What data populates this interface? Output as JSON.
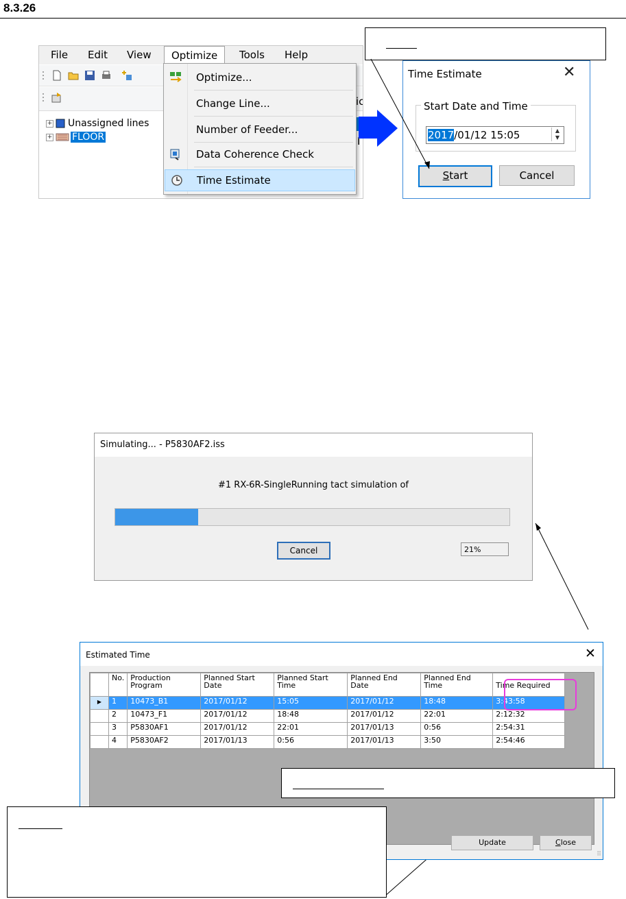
{
  "section": {
    "number": "8.3.26"
  },
  "app_window": {
    "menu": [
      "File",
      "Edit",
      "View",
      "Optimize",
      "Tools",
      "Help"
    ],
    "active_menu": "Optimize",
    "tree": [
      {
        "label": "Unassigned lines"
      },
      {
        "label": "FLOOR"
      }
    ],
    "panel_fragments": [
      "ic",
      "I"
    ],
    "optimize_menu": [
      {
        "label": "Optimize...",
        "icon": "optimize-icon"
      },
      {
        "label": "Change Line...",
        "icon": ""
      },
      {
        "label": "Number of Feeder...",
        "icon": ""
      },
      {
        "label": "Data Coherence Check",
        "icon": "data-check-icon"
      },
      {
        "label": "Time Estimate",
        "icon": "clock-icon"
      }
    ]
  },
  "time_estimate_dialog": {
    "title": "Time Estimate",
    "close": "✕",
    "group_label": "Start Date and Time",
    "value_year": "2017",
    "value_rest": "/01/12 15:05",
    "start_button": "Start",
    "start_button_mnemonic": "S",
    "start_button_rest": "tart",
    "cancel_button": "Cancel"
  },
  "simulating_dialog": {
    "title": "Simulating... - P5830AF2.iss",
    "message": "#1 RX-6R-SingleRunning tact simulation of",
    "progress": 21,
    "progress_label": "21%",
    "cancel": "Cancel"
  },
  "estimated_time_dialog": {
    "title": "Estimated Time",
    "close": "✕",
    "columns": [
      "No.",
      "Production\nProgram",
      "Planned Start\nDate",
      "Planned Start\nTime",
      "Planned End\nDate",
      "Planned End\nTime",
      "Time Required"
    ],
    "rows": [
      [
        "1",
        "10473_B1",
        "2017/01/12",
        "15:05",
        "2017/01/12",
        "18:48",
        "3:43:58"
      ],
      [
        "2",
        "10473_F1",
        "2017/01/12",
        "18:48",
        "2017/01/12",
        "22:01",
        "2:12:32"
      ],
      [
        "3",
        "P5830AF1",
        "2017/01/12",
        "22:01",
        "2017/01/13",
        "0:56",
        "2:54:31"
      ],
      [
        "4",
        "P5830AF2",
        "2017/01/13",
        "0:56",
        "2017/01/13",
        "3:50",
        "2:54:46"
      ]
    ],
    "selected_row": 0,
    "update": "Update",
    "close_button_mnemonic": "C",
    "close_button_rest": "lose"
  },
  "colors": {
    "selection": "#0078d7",
    "row_selection": "#3399ff",
    "highlight_box": "#e83cdc",
    "arrow": "#0033ff",
    "progress": "#3c96e8"
  }
}
